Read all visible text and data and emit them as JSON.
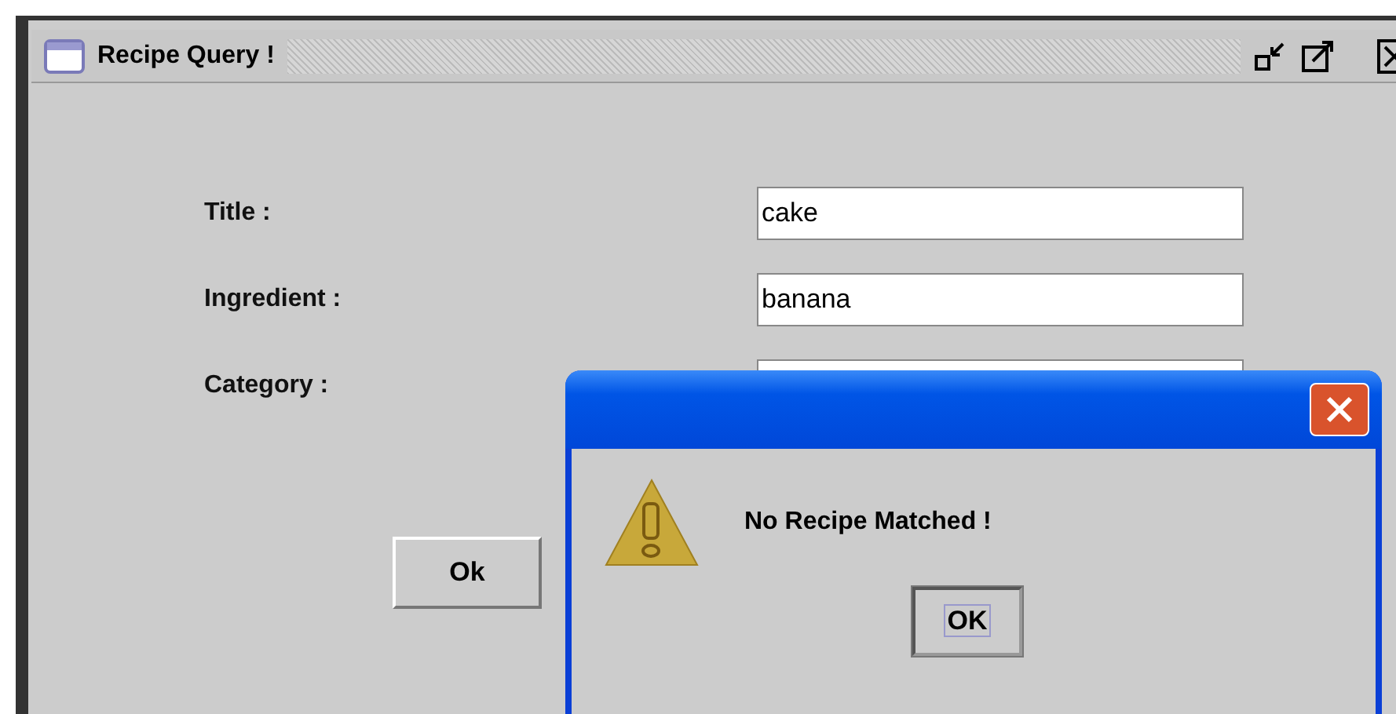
{
  "window": {
    "title": "Recipe Query !"
  },
  "fields": [
    {
      "label": "Title :",
      "value": "cake"
    },
    {
      "label": "Ingredient :",
      "value": "banana"
    },
    {
      "label": "Category :"
    }
  ],
  "buttons": [
    {
      "label": "Ok"
    }
  ],
  "dialog": {
    "message": "No Recipe Matched !",
    "button": {
      "label": "OK",
      "focused": true
    }
  }
}
